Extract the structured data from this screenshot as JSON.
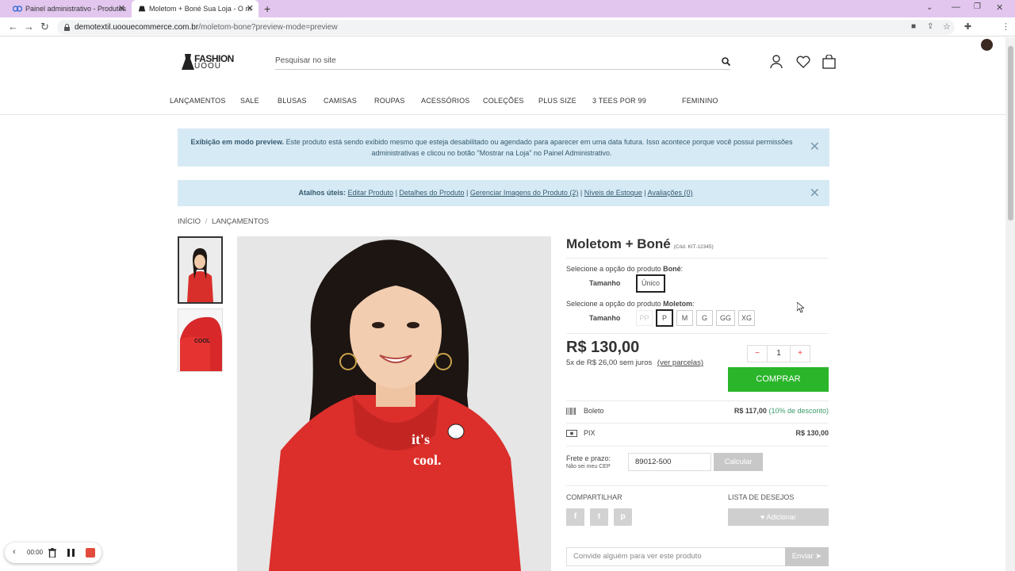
{
  "browser": {
    "tabs": [
      {
        "title": "Painel administrativo - Produtos"
      },
      {
        "title": "Moletom + Boné Sua Loja - O m"
      }
    ],
    "url_domain": "demotextil.uoouecommerce.com.br",
    "url_path": "/moletom-bone?preview-mode=preview"
  },
  "header": {
    "logo_text_top": "FASHION",
    "logo_text_bottom": "UOOU",
    "search_placeholder": "Pesquisar no site",
    "menu": [
      "LANÇAMENTOS",
      "SALE",
      "BLUSAS",
      "CAMISAS",
      "ROUPAS",
      "ACESSÓRIOS",
      "COLEÇÕES",
      "PLUS SIZE",
      "3 TEES POR 99",
      "FEMININO"
    ]
  },
  "alerts": {
    "preview_bold": "Exibição em modo preview.",
    "preview_text": "Este produto está sendo exibido mesmo que esteja desabilitado ou agendado para aparecer em uma data futura. Isso acontece porque você possui permissões",
    "preview_text2": "administrativas e clicou no botão \"Mostrar na Loja\" no Painel Administrativo.",
    "shortcuts_label": "Atalhos úteis:",
    "shortcuts": [
      "Editar Produto",
      "Detalhes do Produto",
      "Gerenciar Imagens do Produto (2)",
      "Níveis de Estoque",
      "Avaliações (0)"
    ]
  },
  "breadcrumb": {
    "home": "INÍCIO",
    "sep": "/",
    "current": "LANÇAMENTOS"
  },
  "product": {
    "name": "Moletom + Boné",
    "code": "(Cód. KIT-12345)",
    "option1_prefix": "Selecione a opção do produto ",
    "option1_name": "Boné",
    "option1_suffix": ":",
    "option1_label": "Tamanho",
    "option1_values": [
      "Único"
    ],
    "option2_prefix": "Selecione a opção do produto ",
    "option2_name": "Moletom",
    "option2_suffix": ":",
    "option2_label": "Tamanho",
    "option2_values": [
      "PP",
      "P",
      "M",
      "G",
      "GG",
      "XG"
    ],
    "price": "R$ 130,00",
    "installments": "5x de R$ 26,00 sem juros",
    "installments_link": "(ver parcelas)",
    "qty": "1",
    "qty_minus": "−",
    "qty_plus": "+",
    "buy_label": "COMPRAR",
    "boleto_label": "Boleto",
    "boleto_price": "R$ 117,00",
    "boleto_discount": "(10% de desconto)",
    "pix_label": "PIX",
    "pix_price": "R$ 130,00",
    "shipping_label": "Frete e prazo:",
    "shipping_help": "Não sei meu CEP",
    "cep_value": "89012-500",
    "calc_label": "Calcular",
    "share_label": "COMPARTILHAR",
    "wishlist_label": "LISTA DE DESEJOS",
    "wishlist_button": "Adicionar",
    "social_icons": [
      "f",
      "t",
      "p"
    ],
    "invite_placeholder": "Convide alguém para ver este produto",
    "send_label": "Enviar",
    "shirt_text1": "it's",
    "shirt_text2": "cool.",
    "cap_text": "COOL"
  },
  "recorder": {
    "time": "00:00"
  },
  "colors": {
    "buy": "#2ab52a",
    "alert": "#d6eaf5",
    "shirt": "#e0302b",
    "discount": "#3a9a6a"
  }
}
